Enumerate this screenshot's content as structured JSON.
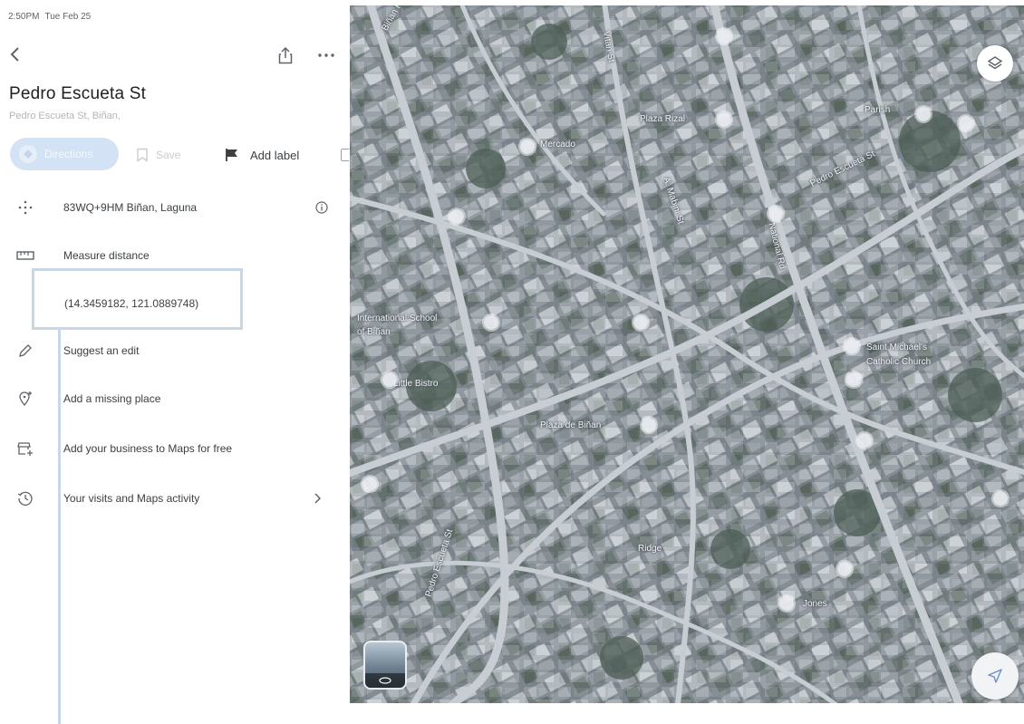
{
  "status_bar": {
    "time": "2:50PM",
    "date": "Tue Feb 25"
  },
  "header": {
    "back_icon": "chevron-left-icon",
    "share_icon": "share-icon",
    "more_icon": "more-horizontal-icon"
  },
  "place": {
    "title": "Pedro Escueta St",
    "subtitle": "Pedro Escueta St, Biñan,"
  },
  "actions": {
    "directions_label": "Directions",
    "save_label": "Save",
    "add_label_label": "Add label"
  },
  "details": {
    "plus_code": "83WQ+9HM Biñan, Laguna",
    "measure_distance": "Measure distance",
    "coordinates": "(14.3459182, 121.0889748)",
    "suggest_edit": "Suggest an edit",
    "add_missing_place": "Add a missing place",
    "add_business": "Add your business to Maps for free",
    "visits_activity": "Your visits and Maps activity"
  },
  "map": {
    "labels": {
      "binan_rd": "Biñan Rd",
      "pedro_escueta_st": "Pedro Escueta St",
      "pedro_escueta_st_2": "Pedro Escueta St",
      "saint_michael": "Saint Michael's",
      "little_bistro": "Little Bistro",
      "international_school": "International School",
      "of_binan": "of Biñan",
      "catholic_church": "Catholic Church",
      "plaza_rizal": "Plaza Rizal",
      "mercado": "Mercado",
      "vk_ridge": "Ridge",
      "national_rd": "National Rd",
      "parish": "Parish",
      "unit_label": "Plaza de Biñan",
      "a_mabini": "A. Mabini St",
      "street_v": "Vitan St",
      "jones": "Jones"
    },
    "layers_icon": "layers-icon",
    "compass_icon": "navigation-arrow-icon",
    "streetview_icon": "street-view-thumbnail"
  }
}
